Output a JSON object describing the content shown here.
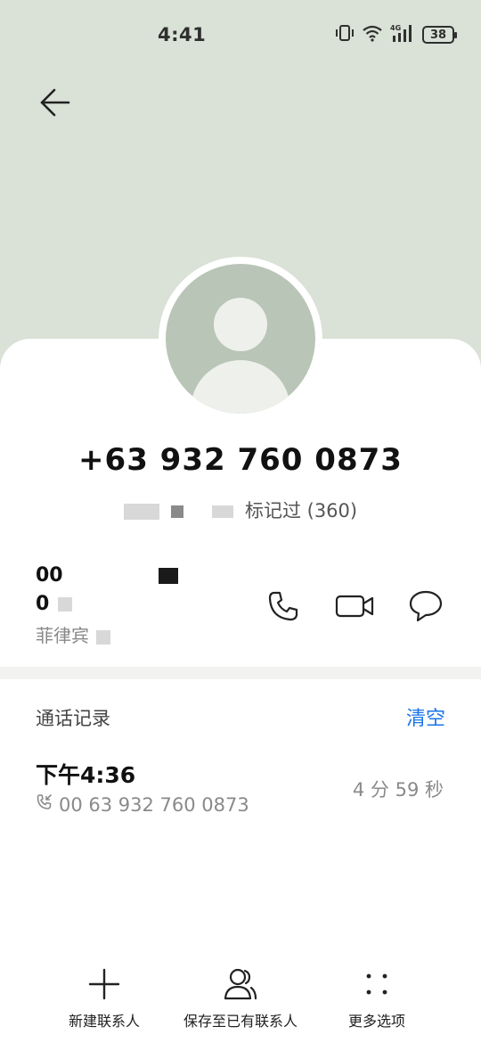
{
  "status_bar": {
    "time": "4:41",
    "battery": "38",
    "network": "4G"
  },
  "contact": {
    "number_title": "+63 932 760 0873",
    "mark_text": "标记过 (360)",
    "number_line1": "00",
    "number_line2": "0",
    "location": "菲律宾"
  },
  "call_log": {
    "title": "通话记录",
    "clear_label": "清空",
    "entries": [
      {
        "time": "下午4:36",
        "number": "00 63 932 760 0873",
        "duration": "4 分 59 秒"
      }
    ]
  },
  "bottom_bar": {
    "new_contact": "新建联系人",
    "save_existing": "保存至已有联系人",
    "more": "更多选项"
  },
  "colors": {
    "header_bg": "#dae1d7",
    "accent": "#1a73e8",
    "avatar": "#b9c5b6"
  },
  "icons": [
    "back-arrow-icon",
    "phone-icon",
    "video-icon",
    "message-icon",
    "plus-icon",
    "person-icon",
    "more-dots-icon"
  ]
}
